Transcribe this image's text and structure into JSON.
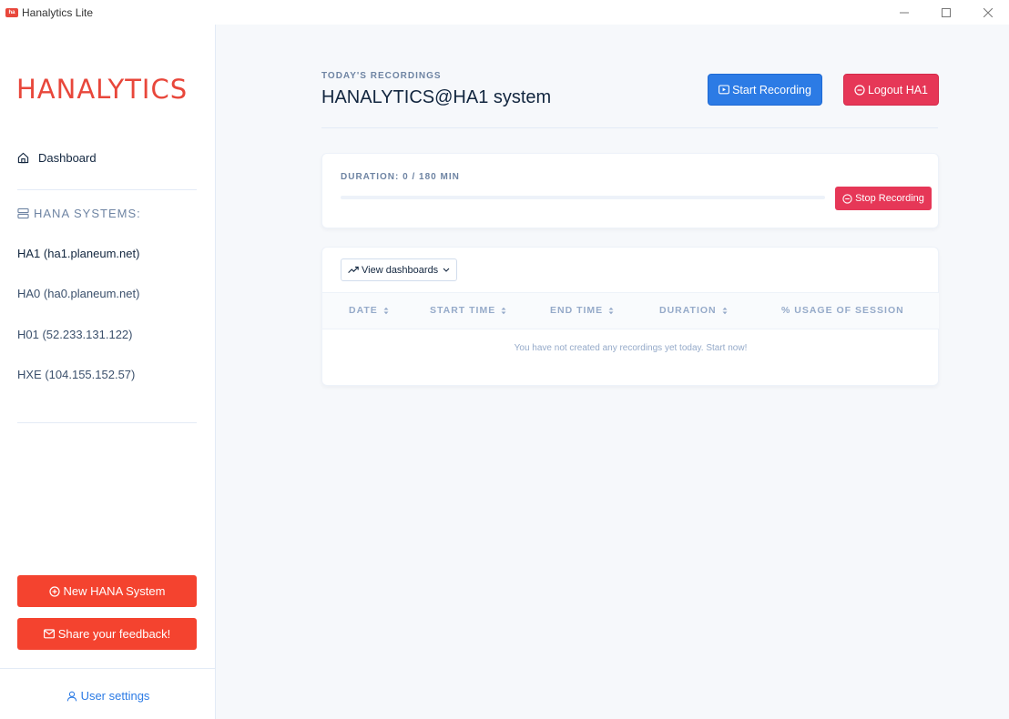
{
  "titlebar": {
    "title": "Hanalytics Lite",
    "app_icon_text": "ha",
    "minimize_icon": "minimize-icon",
    "maximize_icon": "maximize-icon",
    "close_icon": "close-icon"
  },
  "sidebar": {
    "brand": "HANALYTICS",
    "dashboard_label": "Dashboard",
    "section_title": "HANA SYSTEMS:",
    "systems": [
      "HA1 (ha1.planeum.net)",
      "HA0 (ha0.planeum.net)",
      "H01 (52.233.131.122)",
      "HXE (104.155.152.57)"
    ],
    "new_system_label": "New HANA System",
    "feedback_label": "Share your feedback!",
    "user_settings_label": "User settings"
  },
  "header": {
    "pretitle": "TODAY'S RECORDINGS",
    "title": "HANALYTICS@HA1 system",
    "start_recording_label": "Start Recording",
    "logout_label": "Logout HA1"
  },
  "recording": {
    "duration_label": "DURATION: 0 / 180 MIN",
    "progress_fraction": 0,
    "stop_label": "Stop Recording"
  },
  "recordings_table": {
    "view_dashboards_label": "View dashboards",
    "columns": [
      "DATE",
      "START TIME",
      "END TIME",
      "DURATION",
      "% USAGE OF SESSION"
    ],
    "empty_message": "You have not created any recordings yet today. Start now!"
  },
  "colors": {
    "brand": "#e8473b",
    "primary": "#2c7be5",
    "danger": "#e63757",
    "sidebar_button": "#f4432f"
  }
}
